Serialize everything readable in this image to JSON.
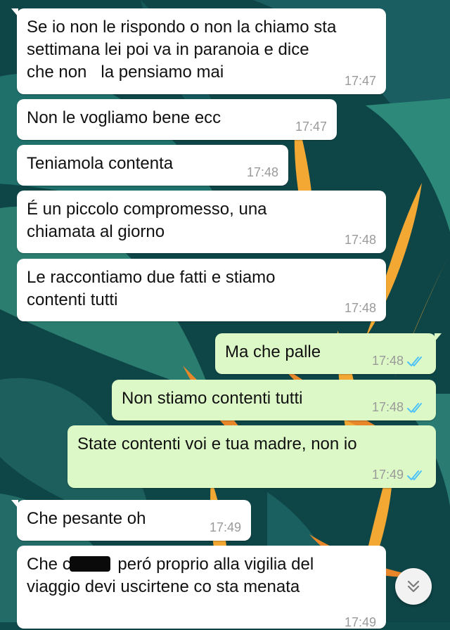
{
  "colors": {
    "incoming_bubble": "#ffffff",
    "outgoing_bubble": "#dcf8c6",
    "timestamp": "#9a9a9a",
    "read_ticks": "#4fc3f7"
  },
  "messages": [
    {
      "direction": "in",
      "text": "Se io non le rispondo o non la chiamo sta\nsettimana lei poi va in paranoia e dice\nche non   la pensiamo mai",
      "time": "17:47"
    },
    {
      "direction": "in",
      "text": "Non le vogliamo bene ecc",
      "time": "17:47"
    },
    {
      "direction": "in",
      "text": "Teniamola contenta",
      "time": "17:48"
    },
    {
      "direction": "in",
      "text": "É un piccolo compromesso, una\nchiamata al giorno",
      "time": "17:48"
    },
    {
      "direction": "in",
      "text": "Le raccontiamo due fatti e stiamo\ncontenti tutti",
      "time": "17:48"
    },
    {
      "direction": "out",
      "text": "Ma che palle",
      "time": "17:48",
      "status_icon": "double-check-read-icon"
    },
    {
      "direction": "out",
      "text": "Non stiamo contenti tutti",
      "time": "17:48",
      "status_icon": "double-check-read-icon"
    },
    {
      "direction": "out",
      "text": "State contenti voi e tua madre, non io",
      "time": "17:49",
      "status_icon": "double-check-read-icon"
    },
    {
      "direction": "in",
      "text": "Che pesante oh",
      "time": "17:49"
    },
    {
      "direction": "in",
      "text_before": "Che c",
      "redacted": true,
      "text_after": " peró proprio alla vigilia del\nviaggio devi uscirtene co sta menata",
      "time": "17:49"
    }
  ],
  "scroll_button": {
    "icon": "double-chevron-down-icon"
  }
}
